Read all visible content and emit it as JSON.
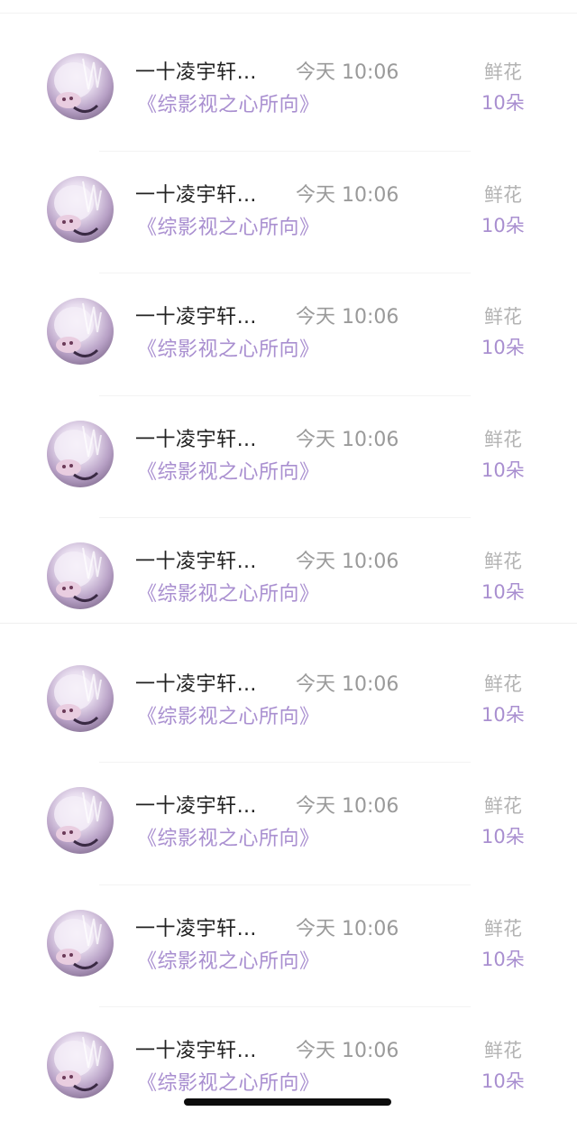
{
  "records": [
    {
      "name": "一十凌宇轩…",
      "time": "今天 10:06",
      "book": "《综影视之心所向》",
      "gift_label": "鲜花",
      "gift_count": "10朵"
    },
    {
      "name": "一十凌宇轩…",
      "time": "今天 10:06",
      "book": "《综影视之心所向》",
      "gift_label": "鲜花",
      "gift_count": "10朵"
    },
    {
      "name": "一十凌宇轩…",
      "time": "今天 10:06",
      "book": "《综影视之心所向》",
      "gift_label": "鲜花",
      "gift_count": "10朵"
    },
    {
      "name": "一十凌宇轩…",
      "time": "今天 10:06",
      "book": "《综影视之心所向》",
      "gift_label": "鲜花",
      "gift_count": "10朵"
    },
    {
      "name": "一十凌宇轩…",
      "time": "今天 10:06",
      "book": "《综影视之心所向》",
      "gift_label": "鲜花",
      "gift_count": "10朵"
    },
    {
      "name": "一十凌宇轩…",
      "time": "今天 10:06",
      "book": "《综影视之心所向》",
      "gift_label": "鲜花",
      "gift_count": "10朵"
    },
    {
      "name": "一十凌宇轩…",
      "time": "今天 10:06",
      "book": "《综影视之心所向》",
      "gift_label": "鲜花",
      "gift_count": "10朵"
    },
    {
      "name": "一十凌宇轩…",
      "time": "今天 10:06",
      "book": "《综影视之心所向》",
      "gift_label": "鲜花",
      "gift_count": "10朵"
    },
    {
      "name": "一十凌宇轩…",
      "time": "今天 10:06",
      "book": "《综影视之心所向》",
      "gift_label": "鲜花",
      "gift_count": "10朵"
    }
  ],
  "colors": {
    "accent": "#a98fd0",
    "muted": "#9a9a9a",
    "text": "#222222"
  },
  "icons": {
    "avatar": "anime-character-avatar"
  }
}
